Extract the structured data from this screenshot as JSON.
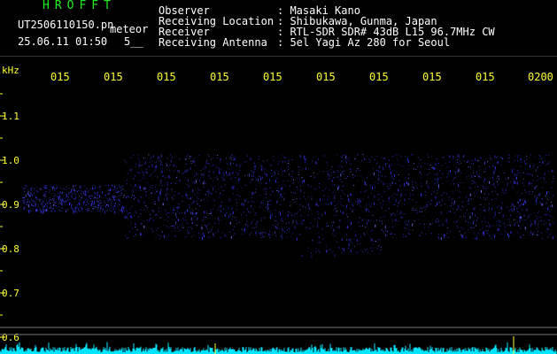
{
  "header": {
    "program_name": "HROFFT",
    "filename": "UT2506110150.pn",
    "meteor_label": "meteor",
    "date_time": "25.06.11 01:50",
    "count": "5__",
    "fields": [
      {
        "label": "Observer",
        "value": ": Masaki Kano"
      },
      {
        "label": "Receiving Location",
        "value": ": Shibukawa, Gunma, Japan"
      },
      {
        "label": "Receiver",
        "value": ": RTL-SDR SDR# 43dB L15 96.7MHz CW"
      },
      {
        "label": "Receiving Antenna",
        "value": ": 5el Yagi Az 280 for Seoul"
      }
    ]
  },
  "axis": {
    "unit": "kHz",
    "y_ticks": [
      "1.1",
      "1.0",
      "0.9",
      "0.8",
      "0.7",
      "0.6"
    ],
    "x_ticks": [
      "015",
      "015",
      "015",
      "015",
      "015",
      "015",
      "015",
      "015",
      "015",
      "0200"
    ]
  },
  "colors": {
    "background": "#000000",
    "header_program": "#22ee22",
    "header_text": "#ffffff",
    "axis_labels": "#ffff33",
    "signal": "#3a3aff",
    "noise_floor": "#00e5ff"
  }
}
